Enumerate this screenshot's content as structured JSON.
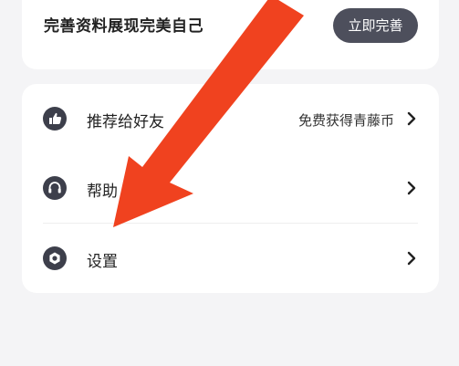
{
  "profile": {
    "text": "完善资料展现完美自己",
    "button_label": "立即完善"
  },
  "menu": {
    "items": [
      {
        "icon": "thumbs-up-icon",
        "label": "推荐给好友",
        "note": "免费获得青藤币"
      },
      {
        "icon": "headset-icon",
        "label": "帮助"
      },
      {
        "icon": "gear-icon",
        "label": "设置"
      }
    ]
  },
  "annotation": {
    "color": "#f0421f",
    "icon": "red-arrow-icon"
  }
}
